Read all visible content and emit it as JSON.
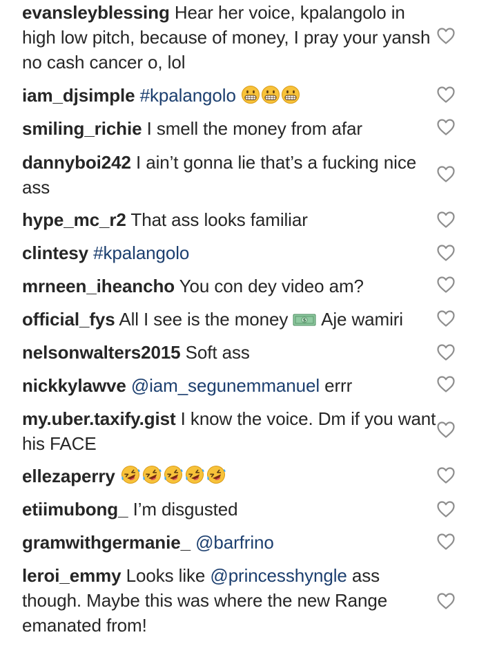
{
  "comments": [
    {
      "username": "evansleyblessing",
      "segments": [
        {
          "type": "text",
          "text": "Hear her voice, kpalangolo in high low pitch, because of money, I pray your yansh no cash cancer o, lol"
        }
      ]
    },
    {
      "username": "iam_djsimple",
      "segments": [
        {
          "type": "mention",
          "text": "#kpalangolo"
        },
        {
          "type": "text",
          "text": " "
        },
        {
          "type": "emoji",
          "icon": "grin-face-emoji"
        },
        {
          "type": "emoji",
          "icon": "grin-face-emoji"
        },
        {
          "type": "emoji",
          "icon": "grin-face-emoji"
        }
      ]
    },
    {
      "username": "smiling_richie",
      "segments": [
        {
          "type": "text",
          "text": "I smell the money from afar"
        }
      ]
    },
    {
      "username": "dannyboi242",
      "segments": [
        {
          "type": "text",
          "text": "I ain’t gonna lie that’s a fucking nice ass"
        }
      ]
    },
    {
      "username": "hype_mc_r2",
      "segments": [
        {
          "type": "text",
          "text": "That ass looks familiar"
        }
      ]
    },
    {
      "username": "clintesy",
      "segments": [
        {
          "type": "mention",
          "text": "#kpalangolo"
        }
      ]
    },
    {
      "username": "mrneen_iheancho",
      "segments": [
        {
          "type": "text",
          "text": "You con dey video am?"
        }
      ]
    },
    {
      "username": "official_fys",
      "segments": [
        {
          "type": "text",
          "text": "All I see is the money "
        },
        {
          "type": "emoji",
          "icon": "dollar-banknote-emoji"
        },
        {
          "type": "text",
          "text": " Aje wamiri"
        }
      ]
    },
    {
      "username": "nelsonwalters2015",
      "segments": [
        {
          "type": "text",
          "text": "Soft ass"
        }
      ]
    },
    {
      "username": "nickkylawve",
      "segments": [
        {
          "type": "mention",
          "text": "@iam_segunemmanuel"
        },
        {
          "type": "text",
          "text": " errr"
        }
      ]
    },
    {
      "username": "my.uber.taxify.gist",
      "segments": [
        {
          "type": "text",
          "text": "I know the voice. Dm if you want his FACE"
        }
      ]
    },
    {
      "username": "ellezaperry",
      "segments": [
        {
          "type": "emoji",
          "icon": "rofl-face-emoji"
        },
        {
          "type": "emoji",
          "icon": "rofl-face-emoji"
        },
        {
          "type": "emoji",
          "icon": "rofl-face-emoji"
        },
        {
          "type": "emoji",
          "icon": "rofl-face-emoji"
        },
        {
          "type": "emoji",
          "icon": "rofl-face-emoji"
        }
      ]
    },
    {
      "username": "etiimubong_",
      "segments": [
        {
          "type": "text",
          "text": "I’m disgusted"
        }
      ]
    },
    {
      "username": "gramwithgermanie_",
      "segments": [
        {
          "type": "mention",
          "text": "@barfrino"
        }
      ]
    },
    {
      "username": "leroi_emmy",
      "segments": [
        {
          "type": "text",
          "text": "Looks like "
        },
        {
          "type": "mention",
          "text": "@princesshyngle"
        },
        {
          "type": "text",
          "text": " ass though. Maybe this was where the new Range emanated from!"
        }
      ]
    }
  ],
  "like_icon": "heart-outline-icon",
  "colors": {
    "text": "#262626",
    "mention": "#1c3f6f",
    "heart": "#8e8e8e",
    "emoji_face": "#f7c23a"
  }
}
